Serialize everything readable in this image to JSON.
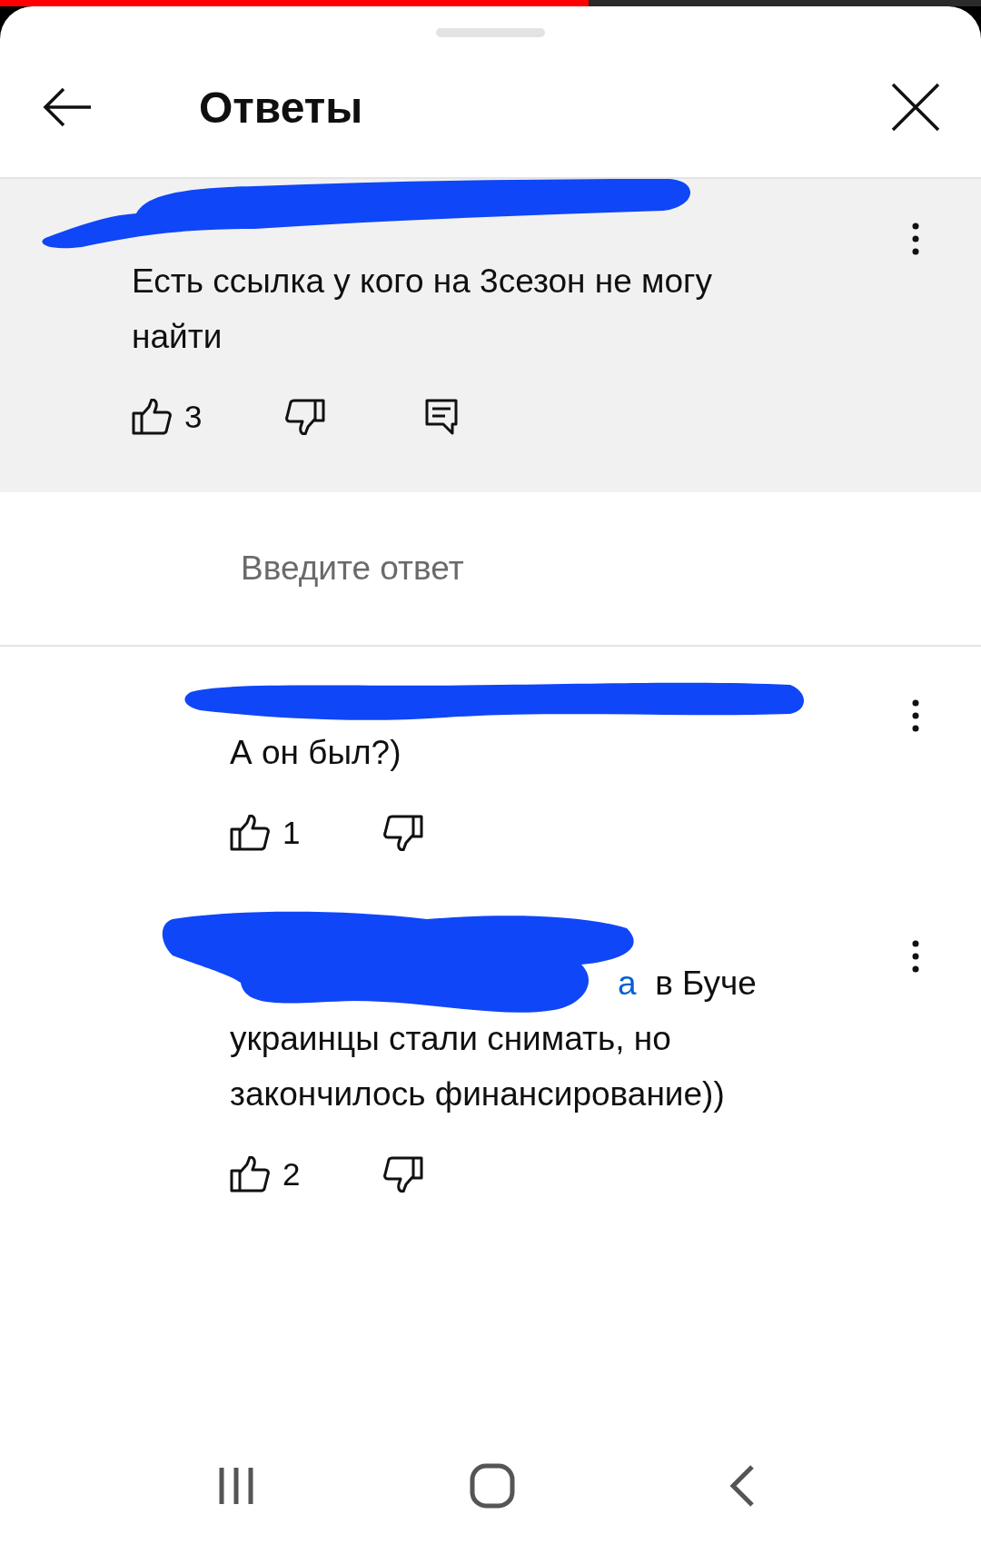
{
  "progress": {
    "level": 0.6
  },
  "header": {
    "title": "Ответы"
  },
  "comment": {
    "text": "Есть ссылка у кого на 3сезон не могу найти",
    "likes": "3"
  },
  "reply_field": {
    "placeholder": "Введите ответ"
  },
  "replies": [
    {
      "text": "А он был?)",
      "likes": "1"
    },
    {
      "mention": "а",
      "text": "в Буче украинцы стали снимать, но закончилось финансирование))",
      "likes": "2"
    }
  ]
}
